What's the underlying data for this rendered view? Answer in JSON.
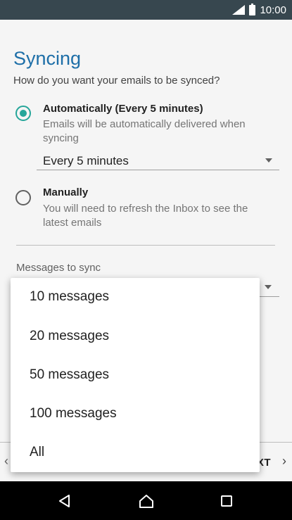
{
  "status_bar": {
    "time": "10:00",
    "icons": [
      "signal-icon",
      "battery-icon"
    ]
  },
  "header": {
    "title": "Syncing",
    "subtitle": "How do you want your emails to be synced?"
  },
  "options": [
    {
      "label": "Automatically (Every 5 minutes)",
      "description": "Emails will be automatically delivered when syncing",
      "checked": true
    },
    {
      "label": "Manually",
      "description": "You will need to refresh the Inbox to see the latest emails",
      "checked": false
    }
  ],
  "frequency_select": {
    "value": "Every 5 minutes"
  },
  "messages_to_sync": {
    "label": "Messages to sync"
  },
  "dropdown": {
    "items": [
      "10 messages",
      "20 messages",
      "50 messages",
      "100 messages",
      "All"
    ]
  },
  "footer": {
    "next_label": "XT"
  },
  "colors": {
    "accent": "#26a69a",
    "title": "#1e6fa8",
    "status_bar": "#37474f"
  }
}
